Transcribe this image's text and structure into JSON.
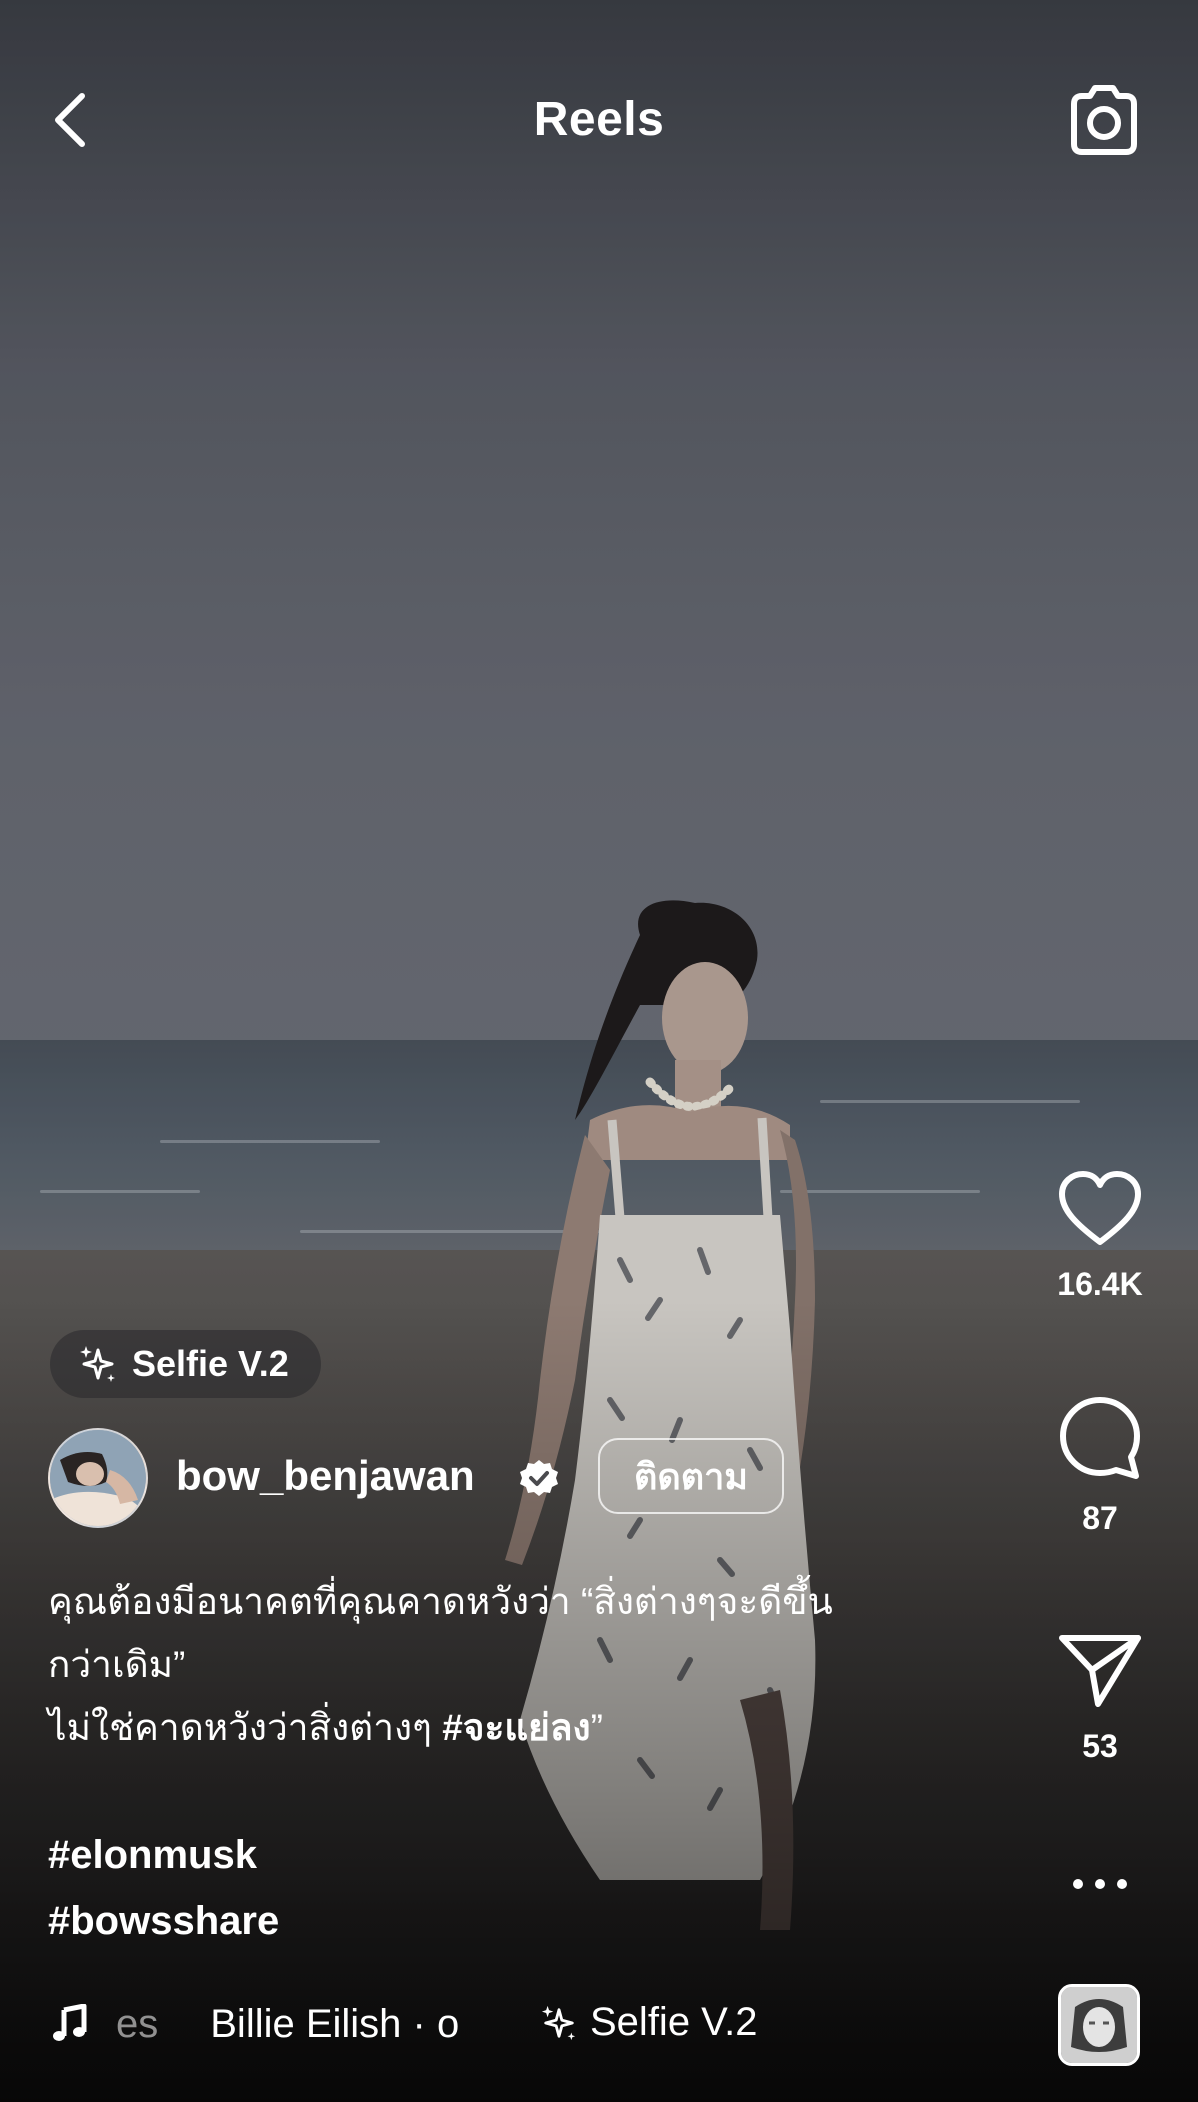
{
  "header": {
    "title": "Reels"
  },
  "actions": {
    "like_count": "16.4K",
    "comment_count": "87",
    "share_count": "53"
  },
  "effect": {
    "label": "Selfie V.2"
  },
  "author": {
    "username": "bow_benjawan",
    "follow_label": "ติดตาม"
  },
  "caption": {
    "line1": "คุณต้องมีอนาคตที่คุณคาดหวังว่า “สิ่งต่างๆจะดีขึ้น",
    "line2": "กว่าเดิม”",
    "line3_text": "ไม่ใช่คาดหวังว่าสิ่งต่างๆ ",
    "line3_tag": "#จะแย่ลง",
    "line3_end": "”",
    "hashtags": [
      "#elonmusk",
      "#bowsshare"
    ]
  },
  "audio": {
    "title_fragment": "es",
    "artist": "Billie Eilish · o"
  },
  "icons": {
    "back": "chevron-left-icon",
    "camera": "camera-icon",
    "like": "heart-icon",
    "comment": "comment-icon",
    "share": "paper-plane-icon",
    "more": "more-dots-icon",
    "music": "music-note-icon",
    "effect": "sparkles-icon",
    "verified": "verified-badge-icon"
  }
}
